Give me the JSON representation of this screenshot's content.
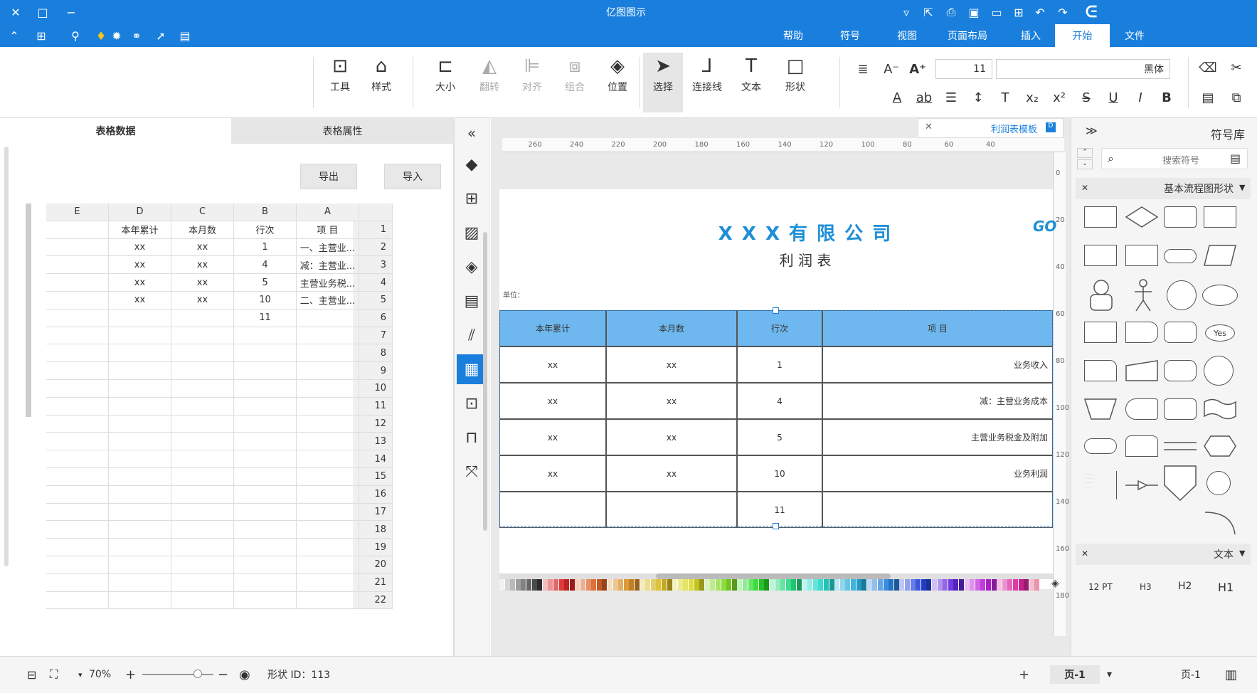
{
  "app": {
    "title": "亿图图示"
  },
  "menu_tabs": [
    "文件",
    "开始",
    "插入",
    "页面布局",
    "视图",
    "符号",
    "帮助"
  ],
  "active_tab": "开始",
  "ribbon": {
    "font_name": "黑体",
    "font_size": "11",
    "big_buttons": [
      "形状",
      "文本",
      "连接线",
      "选择",
      "位置",
      "组合",
      "对齐",
      "翻转",
      "大小",
      "样式",
      "工具"
    ]
  },
  "library": {
    "title": "符号库",
    "search_placeholder": "搜索符号",
    "section1": "基本流程图形状",
    "section2": "文本",
    "text_samples": [
      "H1",
      "H2",
      "H3",
      "12 PT"
    ],
    "yes_label": "Yes"
  },
  "doc_tab": {
    "label": "利润表模板"
  },
  "ruler": {
    "h_ticks": [
      "40",
      "60",
      "80",
      "100",
      "120",
      "140",
      "160",
      "180",
      "200",
      "220",
      "240",
      "260"
    ],
    "v_ticks": [
      "0",
      "20",
      "40",
      "60",
      "80",
      "100",
      "120",
      "140",
      "160",
      "180"
    ]
  },
  "document": {
    "company": "X X X 有 限 公 司",
    "subtitle": "利 润 表",
    "unit_label": "单位：",
    "side_text": "GO",
    "headers": [
      "项 目",
      "行次",
      "本月数",
      "本年累计"
    ],
    "rows": [
      [
        "业务收入",
        "1",
        "xx",
        "xx"
      ],
      [
        "减：主营业务成本",
        "4",
        "xx",
        "xx"
      ],
      [
        "主营业务税金及附加",
        "5",
        "xx",
        "xx"
      ],
      [
        "业务利润",
        "10",
        "xx",
        "xx"
      ],
      [
        "",
        "11",
        "",
        ""
      ]
    ]
  },
  "panel": {
    "tabs": [
      "表格数据",
      "表格属性"
    ],
    "import_label": "导入",
    "export_label": "导出",
    "columns": [
      "A",
      "B",
      "C",
      "D",
      "E"
    ],
    "row_numbers": [
      "1",
      "2",
      "3",
      "4",
      "5",
      "6",
      "7",
      "8",
      "9",
      "10",
      "11",
      "12",
      "13",
      "14",
      "15",
      "16",
      "17",
      "18",
      "19",
      "20",
      "21",
      "22"
    ],
    "cells": [
      [
        "项 目",
        "行次",
        "本月数",
        "本年累计",
        ""
      ],
      [
        "一、主营业...",
        "1",
        "xx",
        "xx",
        ""
      ],
      [
        "减：主营业...",
        "4",
        "xx",
        "xx",
        ""
      ],
      [
        "主营业务税...",
        "5",
        "xx",
        "xx",
        ""
      ],
      [
        "二、主营业...",
        "10",
        "xx",
        "xx",
        ""
      ],
      [
        "",
        "11",
        "",
        "",
        ""
      ]
    ]
  },
  "status": {
    "page_label": "页-1",
    "page_tab": "页-1",
    "shape_id": "形状 ID：113",
    "zoom": "70%"
  },
  "colors": {
    "accent": "#1a7fdc",
    "header_fill": "#6fb8ef",
    "title_blue": "#1e8fd6"
  }
}
